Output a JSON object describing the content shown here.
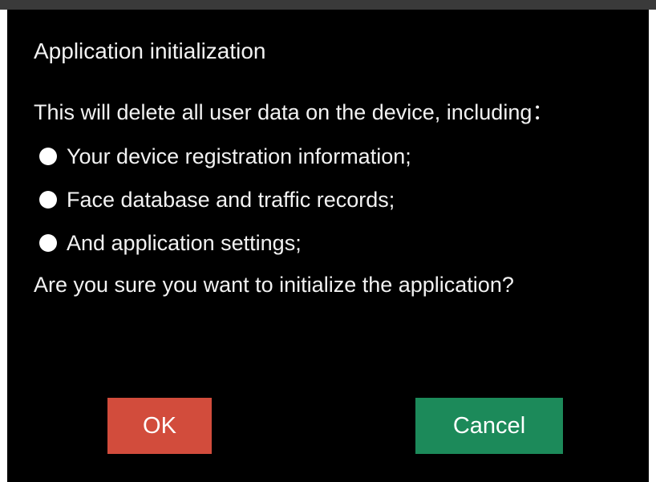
{
  "dialog": {
    "title": "Application initialization",
    "message": "This will delete all user data on the device, including：",
    "items": [
      {
        "label": "Your device registration information;"
      },
      {
        "label": "Face database and traffic records;"
      },
      {
        "label": "And application settings;"
      }
    ],
    "question": "Are you sure you want to initialize the application?",
    "ok_label": "OK",
    "cancel_label": "Cancel"
  },
  "colors": {
    "background": "#000000",
    "text": "#f2f2f2",
    "ok_button": "#d24c3c",
    "cancel_button": "#1c8a5a"
  }
}
